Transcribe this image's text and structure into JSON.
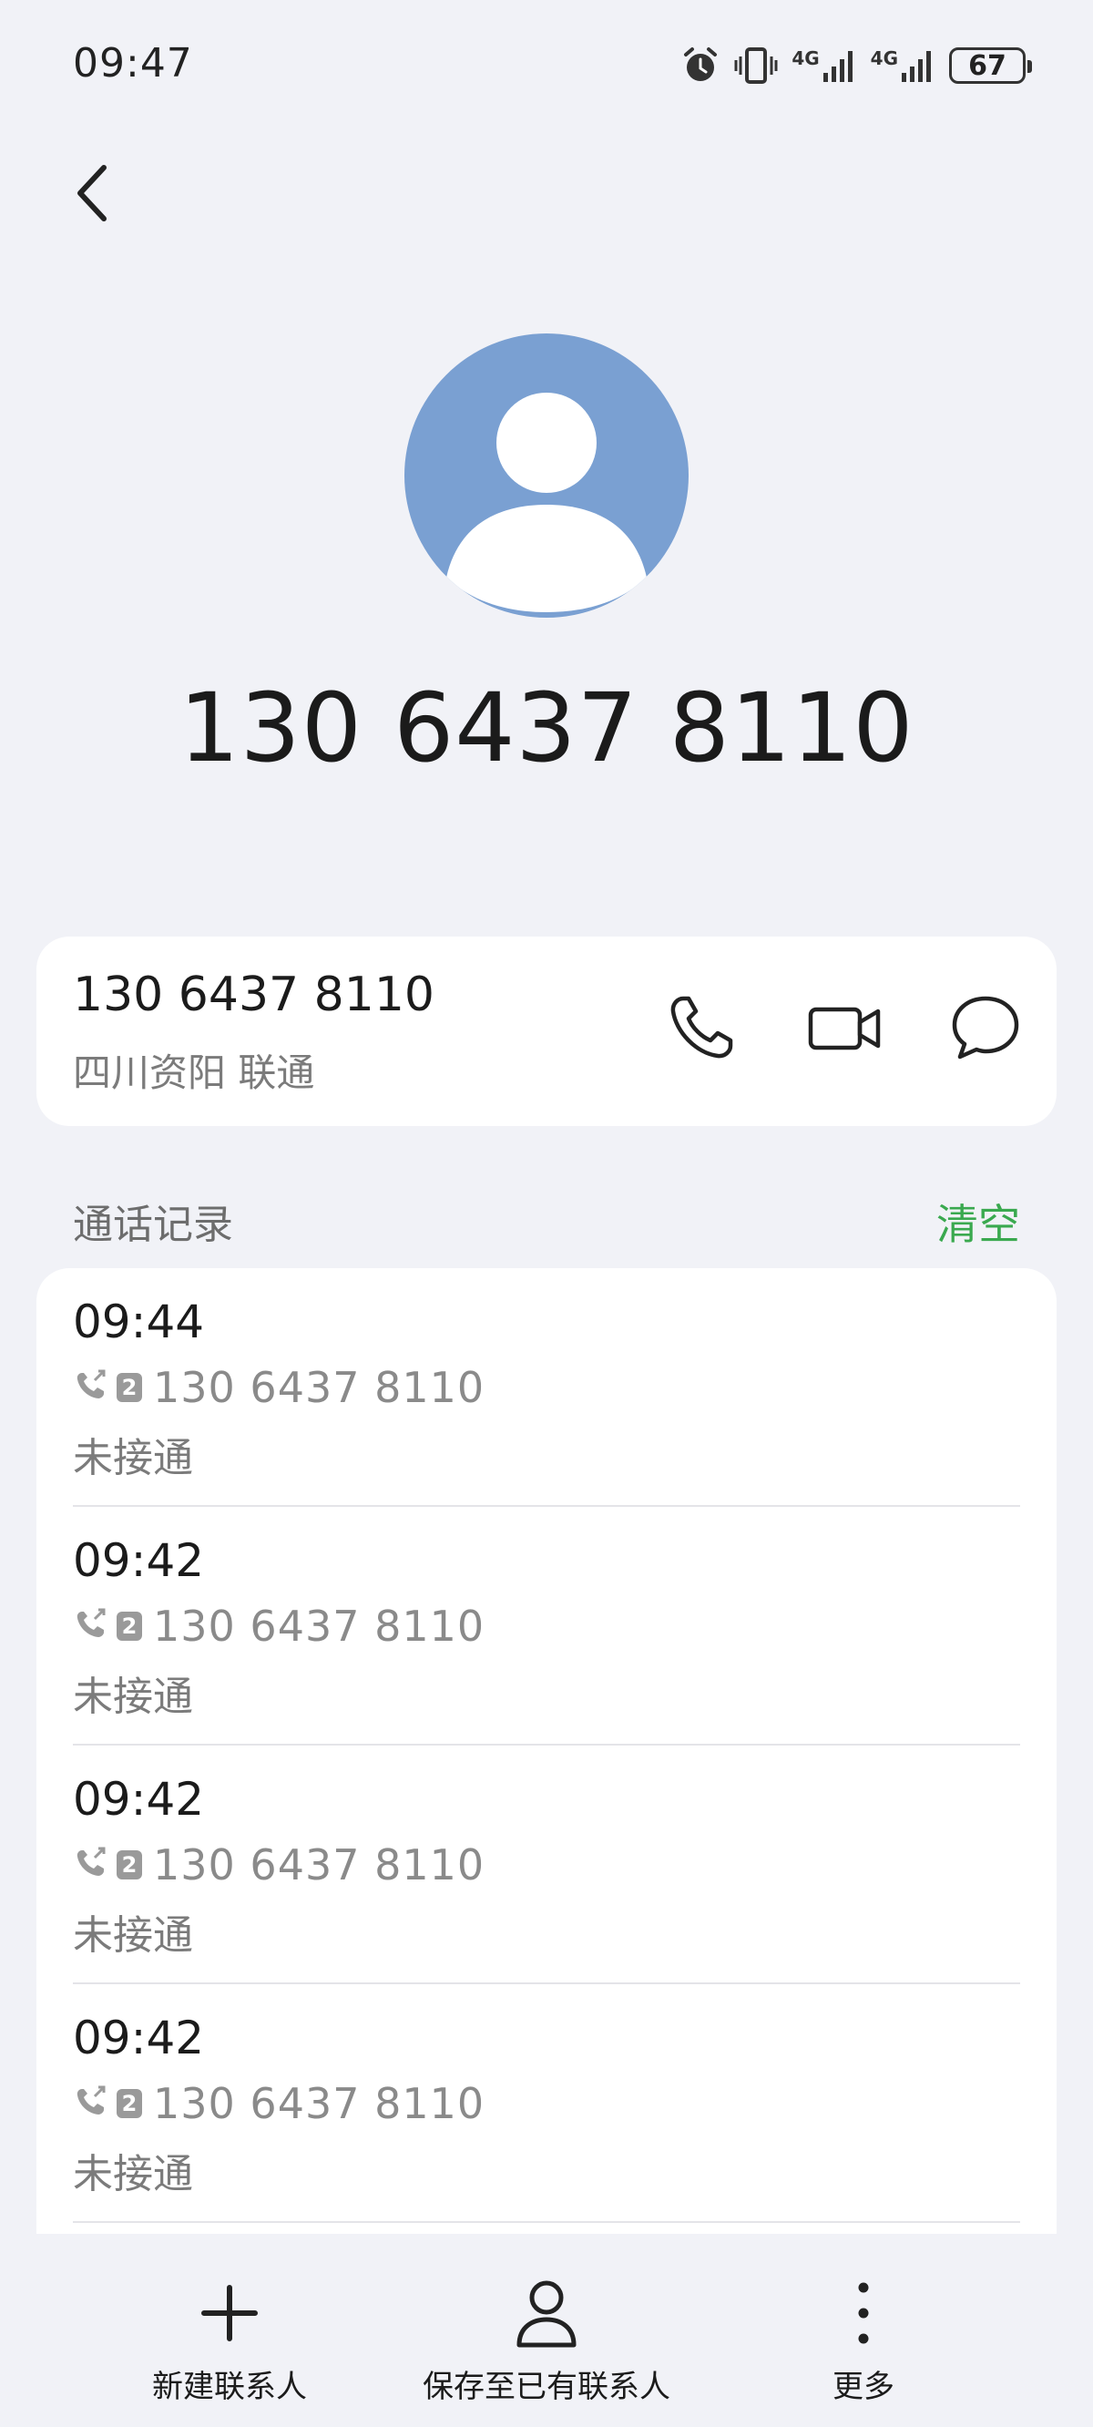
{
  "status_bar": {
    "time": "09:47",
    "icons": [
      "alarm-icon",
      "vibrate-icon",
      "signal-4g-sim1-icon",
      "signal-4g-sim2-icon",
      "battery-icon"
    ],
    "network_labels": [
      "4G",
      "4G"
    ],
    "battery": "67"
  },
  "contact": {
    "avatar_color": "#7aa0d2",
    "name": "130 6437 8110",
    "number": "130 6437 8110",
    "location": "四川资阳 联通"
  },
  "actions": [
    "phone-icon",
    "video-call-icon",
    "message-icon"
  ],
  "call_log": {
    "title": "通话记录",
    "clear_label": "清空",
    "accent_color": "#3aa94f",
    "items": [
      {
        "time": "09:44",
        "sim": "2",
        "number": "130 6437 8110",
        "status": "未接通"
      },
      {
        "time": "09:42",
        "sim": "2",
        "number": "130 6437 8110",
        "status": "未接通"
      },
      {
        "time": "09:42",
        "sim": "2",
        "number": "130 6437 8110",
        "status": "未接通"
      },
      {
        "time": "09:42",
        "sim": "2",
        "number": "130 6437 8110",
        "status": "未接通"
      }
    ]
  },
  "bottom_bar": {
    "new_contact": "新建联系人",
    "save_existing": "保存至已有联系人",
    "more": "更多"
  }
}
